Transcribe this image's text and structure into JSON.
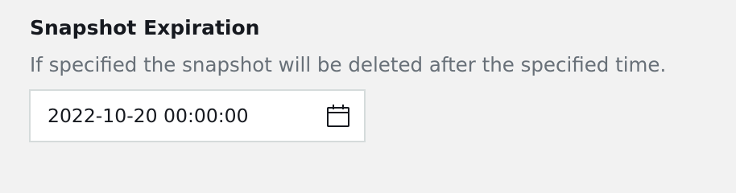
{
  "field": {
    "label": "Snapshot Expiration",
    "description": "If specified the snapshot will be deleted after the specified time.",
    "value": "2022-10-20 00:00:00",
    "icon": "calendar-icon"
  }
}
